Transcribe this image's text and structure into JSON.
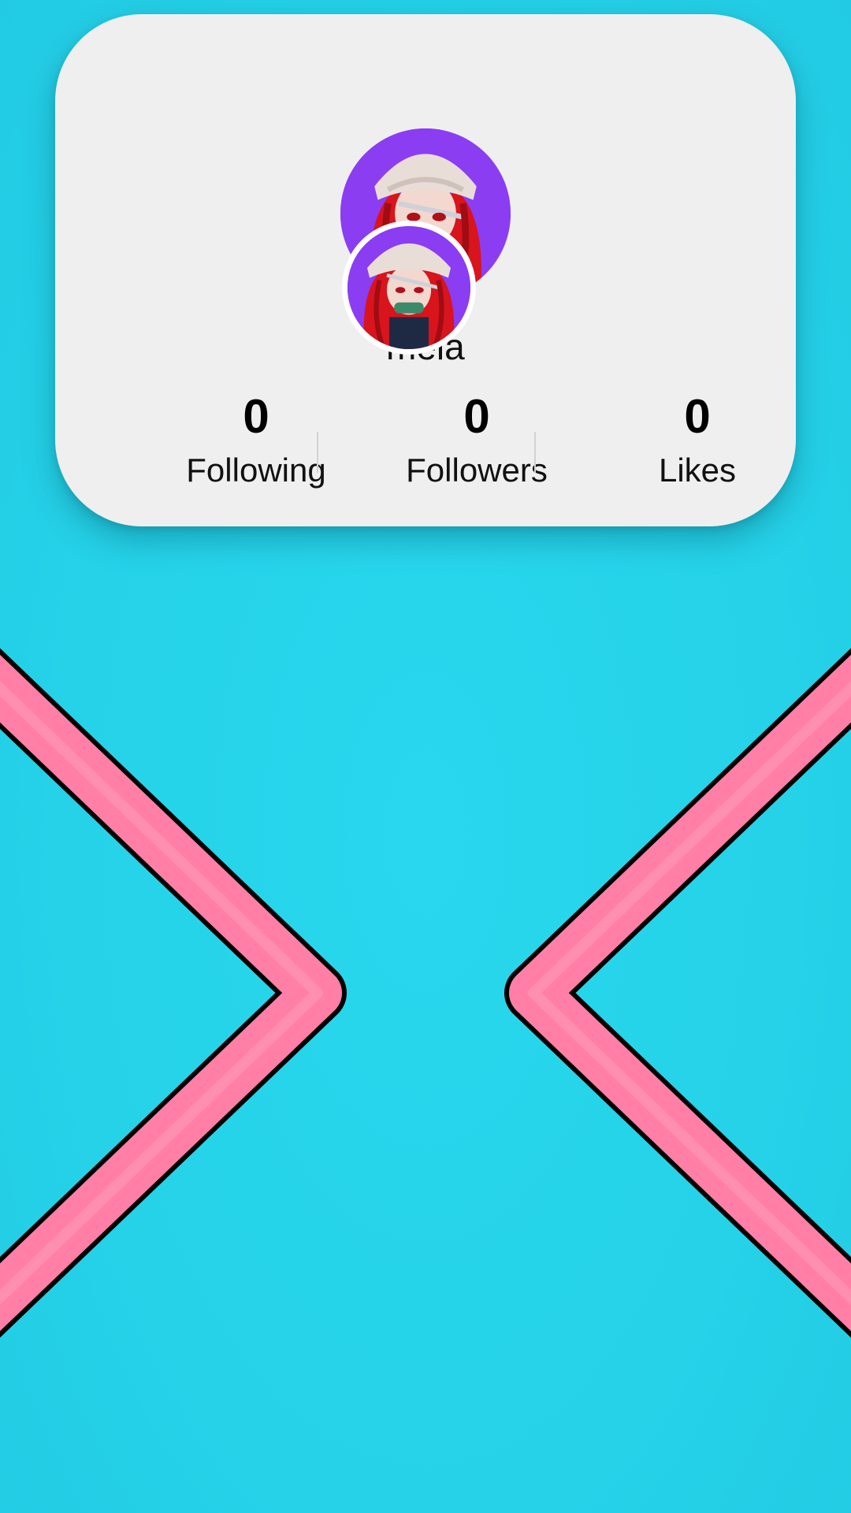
{
  "profile": {
    "username": "mela"
  },
  "stats": [
    {
      "count": "0",
      "label": "Following"
    },
    {
      "count": "0",
      "label": "Followers"
    },
    {
      "count": "0",
      "label": "Likes"
    }
  ],
  "colors": {
    "background": "#27d3e9",
    "card": "#efeff0",
    "chevron_fill": "#ff7fa6",
    "chevron_stroke": "#000000",
    "avatar_bg": "#8b3df2"
  },
  "icons": {
    "left_chevron": "chevron-right-icon",
    "right_chevron": "chevron-left-icon"
  }
}
